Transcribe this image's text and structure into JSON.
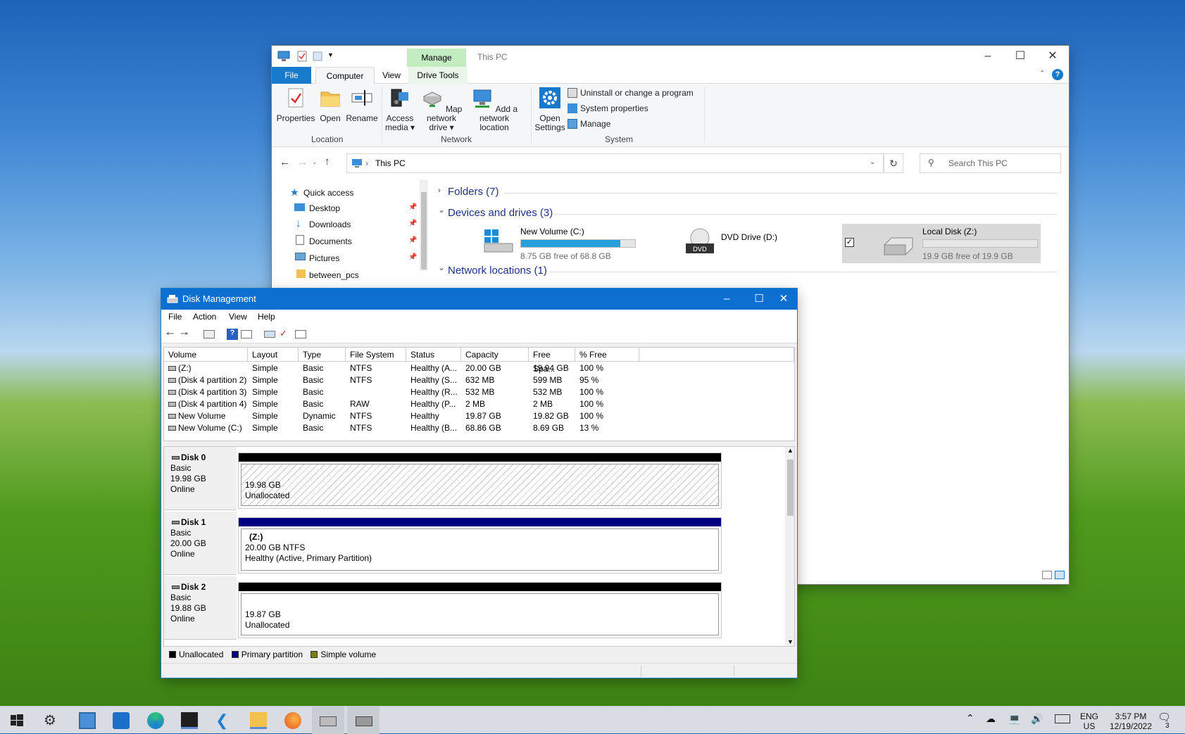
{
  "explorer": {
    "title": "This PC",
    "manage_tab": "Manage",
    "tabs": {
      "file": "File",
      "computer": "Computer",
      "view": "View",
      "drive_tools": "Drive Tools"
    },
    "ribbon": {
      "properties": "Properties",
      "open": "Open",
      "rename": "Rename",
      "access_media": "Access media ▾",
      "map_network_drive": "Map network drive ▾",
      "add_network_location": "Add a network location",
      "open_settings": "Open Settings",
      "uninstall": "Uninstall or change a program",
      "system_properties": "System properties",
      "manage": "Manage",
      "group_location": "Location",
      "group_network": "Network",
      "group_system": "System"
    },
    "address": "This PC",
    "search_placeholder": "Search This PC",
    "nav": {
      "quick_access": "Quick access",
      "desktop": "Desktop",
      "downloads": "Downloads",
      "documents": "Documents",
      "pictures": "Pictures",
      "between_pcs": "between_pcs"
    },
    "sections": {
      "folders": "Folders (7)",
      "devices": "Devices and drives (3)",
      "network": "Network locations (1)"
    },
    "drives": [
      {
        "name": "New Volume (C:)",
        "free": "8.75 GB free of 68.8 GB",
        "used_fraction": 0.87
      },
      {
        "name": "DVD Drive (D:)",
        "dvd_label": "DVD"
      },
      {
        "name": "Local Disk (Z:)",
        "free": "19.9 GB free of 19.9 GB",
        "used_fraction": 0.0
      }
    ]
  },
  "dm": {
    "title": "Disk Management",
    "menu": {
      "file": "File",
      "action": "Action",
      "view": "View",
      "help": "Help"
    },
    "columns": {
      "volume": "Volume",
      "layout": "Layout",
      "type": "Type",
      "fs": "File System",
      "status": "Status",
      "capacity": "Capacity",
      "free": "Free Spa...",
      "pct": "% Free"
    },
    "rows": [
      {
        "volume": "(Z:)",
        "layout": "Simple",
        "type": "Basic",
        "fs": "NTFS",
        "status": "Healthy (A...",
        "capacity": "20.00 GB",
        "free": "19.94 GB",
        "pct": "100 %"
      },
      {
        "volume": "(Disk 4 partition 2)",
        "layout": "Simple",
        "type": "Basic",
        "fs": "NTFS",
        "status": "Healthy (S...",
        "capacity": "632 MB",
        "free": "599 MB",
        "pct": "95 %"
      },
      {
        "volume": "(Disk 4 partition 3)",
        "layout": "Simple",
        "type": "Basic",
        "fs": "",
        "status": "Healthy (R...",
        "capacity": "532 MB",
        "free": "532 MB",
        "pct": "100 %"
      },
      {
        "volume": "(Disk 4 partition 4)",
        "layout": "Simple",
        "type": "Basic",
        "fs": "RAW",
        "status": "Healthy (P...",
        "capacity": "2 MB",
        "free": "2 MB",
        "pct": "100 %"
      },
      {
        "volume": "New Volume",
        "layout": "Simple",
        "type": "Dynamic",
        "fs": "NTFS",
        "status": "Healthy",
        "capacity": "19.87 GB",
        "free": "19.82 GB",
        "pct": "100 %"
      },
      {
        "volume": "New Volume (C:)",
        "layout": "Simple",
        "type": "Basic",
        "fs": "NTFS",
        "status": "Healthy (B...",
        "capacity": "68.86 GB",
        "free": "8.69 GB",
        "pct": "13 %"
      }
    ],
    "disks": [
      {
        "name": "Disk 0",
        "type": "Basic",
        "size": "19.98 GB",
        "state": "Online",
        "part_title": "",
        "part_line1": "19.98 GB",
        "part_line2": "Unallocated"
      },
      {
        "name": "Disk 1",
        "type": "Basic",
        "size": "20.00 GB",
        "state": "Online",
        "part_title": "(Z:)",
        "part_line1": "20.00 GB NTFS",
        "part_line2": "Healthy (Active, Primary Partition)"
      },
      {
        "name": "Disk 2",
        "type": "Basic",
        "size": "19.88 GB",
        "state": "Online",
        "part_title": "",
        "part_line1": "19.87 GB",
        "part_line2": "Unallocated"
      }
    ],
    "legend": {
      "unallocated": "Unallocated",
      "primary": "Primary partition",
      "simple": "Simple volume"
    }
  },
  "taskbar": {
    "lang1": "ENG",
    "lang2": "US",
    "time": "3:57 PM",
    "date": "12/19/2022",
    "notif_count": "3"
  },
  "colors": {
    "accent": "#1979ca",
    "dm_title": "#0d6fd0",
    "primary_partition": "#000080",
    "unallocated": "#000000",
    "simple_volume": "#808000",
    "drive_bar": "#26a0da"
  }
}
